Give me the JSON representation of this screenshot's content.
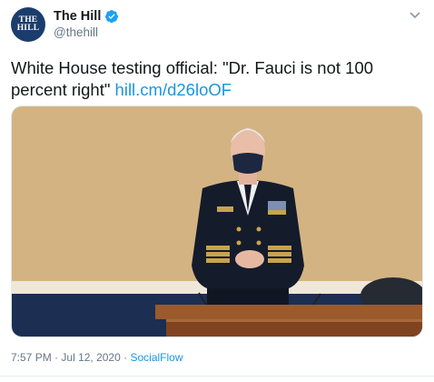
{
  "account": {
    "avatar_text": [
      "THE",
      "HILL"
    ],
    "display_name": "The Hill",
    "handle": "@thehill",
    "verified": true
  },
  "tweet": {
    "text": "White House testing official: \"Dr. Fauci is not 100 percent right\"",
    "link_text": "hill.cm/d26loOF",
    "image_alt": "Official in a dark naval dress uniform and face mask standing behind a wooden witness table"
  },
  "meta": {
    "time": "7:57 PM",
    "date": "Jul 12, 2020",
    "separator": "·",
    "source": "SocialFlow"
  },
  "colors": {
    "link": "#1b95e0",
    "verified": "#1da1f2",
    "secondary_text": "#657786",
    "avatar_bg": "#1b3d6d"
  },
  "icons": [
    "verified-badge-icon",
    "chevron-down-icon"
  ]
}
